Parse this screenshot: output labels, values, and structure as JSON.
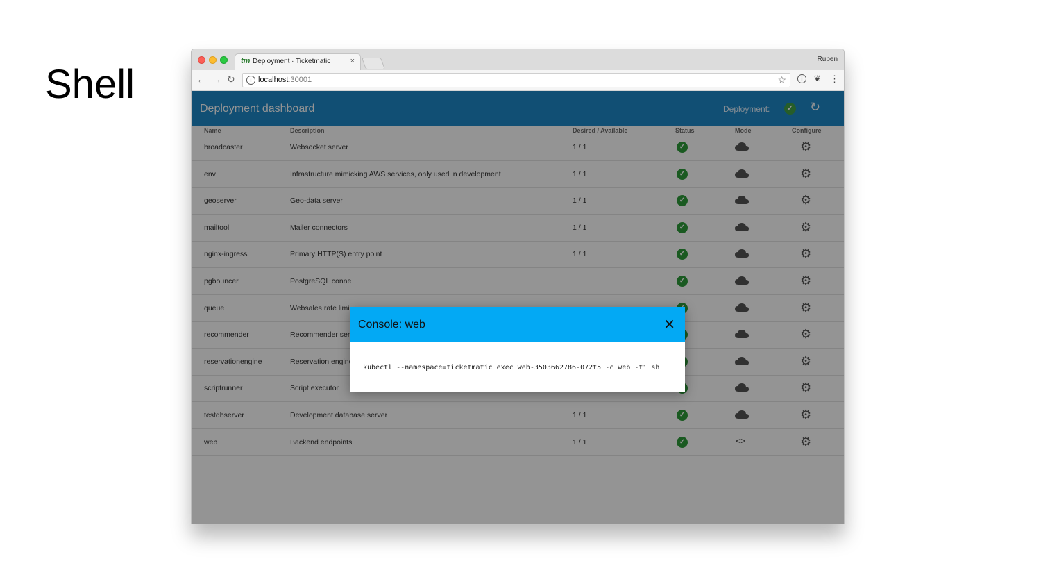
{
  "slide": {
    "title": "Shell"
  },
  "browser": {
    "tab_logo": "tm",
    "tab_title": "Deployment · Ticketmatic",
    "tab_close": "×",
    "profile": "Ruben",
    "url_host": "localhost",
    "url_port": ":30001"
  },
  "app": {
    "title": "Deployment dashboard",
    "deployment_label": "Deployment:",
    "colors": {
      "appbar": "#1e88c9",
      "ok": "#2e9c3a",
      "dialog_header": "#03a9f4"
    }
  },
  "table": {
    "headers": {
      "name": "Name",
      "description": "Description",
      "avail": "Desired / Available",
      "status": "Status",
      "mode": "Mode",
      "configure": "Configure"
    },
    "rows": [
      {
        "name": "broadcaster",
        "description": "Websocket server",
        "avail": "1 / 1",
        "status": "ok",
        "mode": "cloud-icon"
      },
      {
        "name": "env",
        "description": "Infrastructure mimicking AWS services, only used in development",
        "avail": "1 / 1",
        "status": "ok",
        "mode": "cloud-icon"
      },
      {
        "name": "geoserver",
        "description": "Geo-data server",
        "avail": "1 / 1",
        "status": "ok",
        "mode": "cloud-icon"
      },
      {
        "name": "mailtool",
        "description": "Mailer connectors",
        "avail": "1 / 1",
        "status": "ok",
        "mode": "cloud-icon"
      },
      {
        "name": "nginx-ingress",
        "description": "Primary HTTP(S) entry point",
        "avail": "1 / 1",
        "status": "ok",
        "mode": "cloud-icon"
      },
      {
        "name": "pgbouncer",
        "description": "PostgreSQL conne",
        "avail": "",
        "status": "ok",
        "mode": "cloud-icon"
      },
      {
        "name": "queue",
        "description": "Websales rate limi",
        "avail": "",
        "status": "ok",
        "mode": "cloud-icon"
      },
      {
        "name": "recommender",
        "description": "Recommender ser",
        "avail": "",
        "status": "ok",
        "mode": "cloud-icon"
      },
      {
        "name": "reservationengine",
        "description": "Reservation engine",
        "avail": "1 / 1",
        "status": "ok",
        "mode": "cloud-icon"
      },
      {
        "name": "scriptrunner",
        "description": "Script executor",
        "avail": "1 / 1",
        "status": "ok",
        "mode": "cloud-icon"
      },
      {
        "name": "testdbserver",
        "description": "Development database server",
        "avail": "1 / 1",
        "status": "ok",
        "mode": "cloud-icon"
      },
      {
        "name": "web",
        "description": "Backend endpoints",
        "avail": "1 / 1",
        "status": "ok",
        "mode": "code-icon"
      }
    ]
  },
  "dialog": {
    "title": "Console: web",
    "close": "✕",
    "command": "kubectl --namespace=ticketmatic exec web-3503662786-072t5 -c web -ti sh"
  }
}
